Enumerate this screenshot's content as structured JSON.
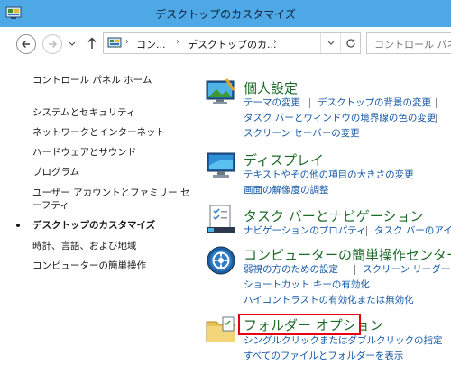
{
  "window": {
    "title": "デスクトップのカスタマイズ"
  },
  "address": {
    "crumbs": [
      "コン...",
      "デスクトップのカ..."
    ],
    "search_placeholder": "コントロール パネ"
  },
  "sidebar": {
    "home": "コントロール パネル ホーム",
    "items": [
      "システムとセキュリティ",
      "ネットワークとインターネット",
      "ハードウェアとサウンド",
      "プログラム",
      "ユーザー アカウントとファミリー セーフティ",
      "デスクトップのカスタマイズ",
      "時計、言語、および地域",
      "コンピューターの簡単操作"
    ]
  },
  "categories": {
    "personalize": {
      "title": "個人設定",
      "tasks": [
        "テーマの変更",
        "デスクトップの背景の変更",
        "タスク バーとウィンドウの境界線の色の変更",
        "スクリーン セーバーの変更"
      ]
    },
    "display": {
      "title": "ディスプレイ",
      "tasks": [
        "テキストやその他の項目の大きさの変更",
        "画面の解像度の調整"
      ]
    },
    "taskbar": {
      "title": "タスク バーとナビゲーション",
      "tasks": [
        "ナビゲーションのプロパティ",
        "タスク バーのアイコン"
      ]
    },
    "ease": {
      "title": "コンピューターの簡単操作センター",
      "tasks": [
        "弱視の方のための設定",
        "スクリーン リーダーの使",
        "ショートカット キーの有効化",
        "ハイコントラストの有効化または無効化"
      ]
    },
    "folder": {
      "title": "フォルダー オプション",
      "tasks": [
        "シングルクリックまたはダブルクリックの指定",
        "すべてのファイルとフォルダーを表示"
      ]
    }
  },
  "colors": {
    "title_bar": "#4ea8e6",
    "category_title": "#1e6b29",
    "task_link": "#1558a6",
    "highlight": "#e60012"
  }
}
